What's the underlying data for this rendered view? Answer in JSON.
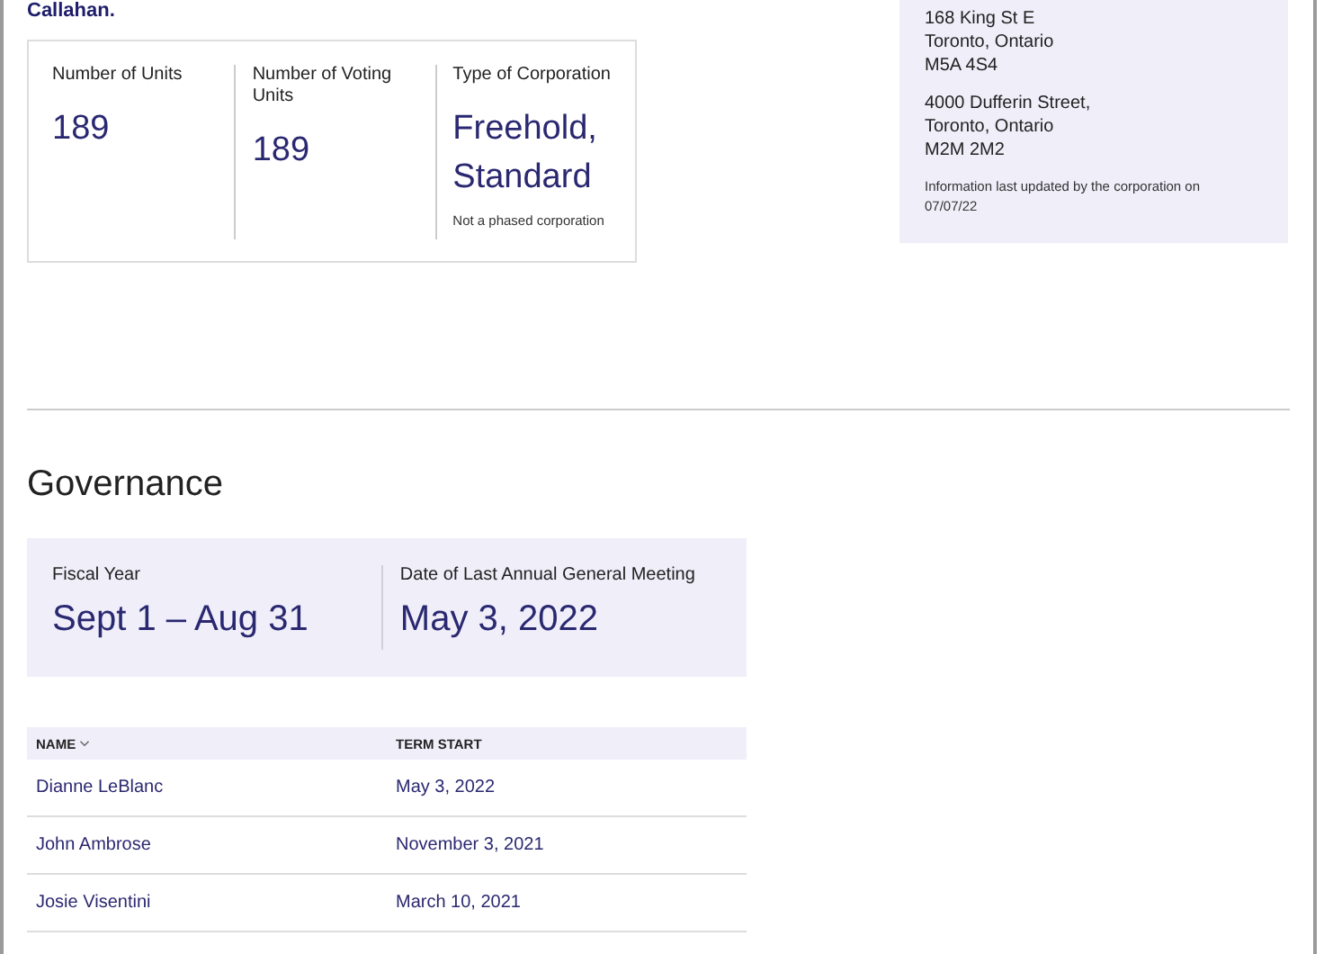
{
  "intro_text_end": "Callahan.",
  "unit_stats": [
    {
      "label": "Number of Units",
      "value": "189"
    },
    {
      "label": "Number of Voting Units",
      "value": "189"
    },
    {
      "label": "Type of Corporation",
      "value": "Freehold, Standard",
      "note": "Not a phased corporation"
    }
  ],
  "addresses": [
    {
      "lines": [
        "168 King St E",
        "Toronto, Ontario",
        "M5A 4S4"
      ]
    },
    {
      "lines": [
        "4000 Dufferin Street,",
        "Toronto, Ontario",
        "M2M 2M2"
      ]
    }
  ],
  "address_note": "Information last updated by the corporation on 07/07/22",
  "governance": {
    "title": "Governance",
    "stats": [
      {
        "label": "Fiscal Year",
        "value": "Sept 1 – Aug 31"
      },
      {
        "label": "Date of Last Annual General Meeting",
        "value": "May 3, 2022"
      }
    ],
    "table": {
      "columns": [
        {
          "label": "NAME",
          "sorted": true
        },
        {
          "label": "TERM START",
          "sorted": false
        }
      ],
      "rows": [
        [
          "Dianne LeBlanc",
          "May 3, 2022"
        ],
        [
          "John Ambrose",
          "November 3, 2021"
        ],
        [
          "Josie Visentini",
          "March 10, 2021"
        ]
      ]
    }
  }
}
